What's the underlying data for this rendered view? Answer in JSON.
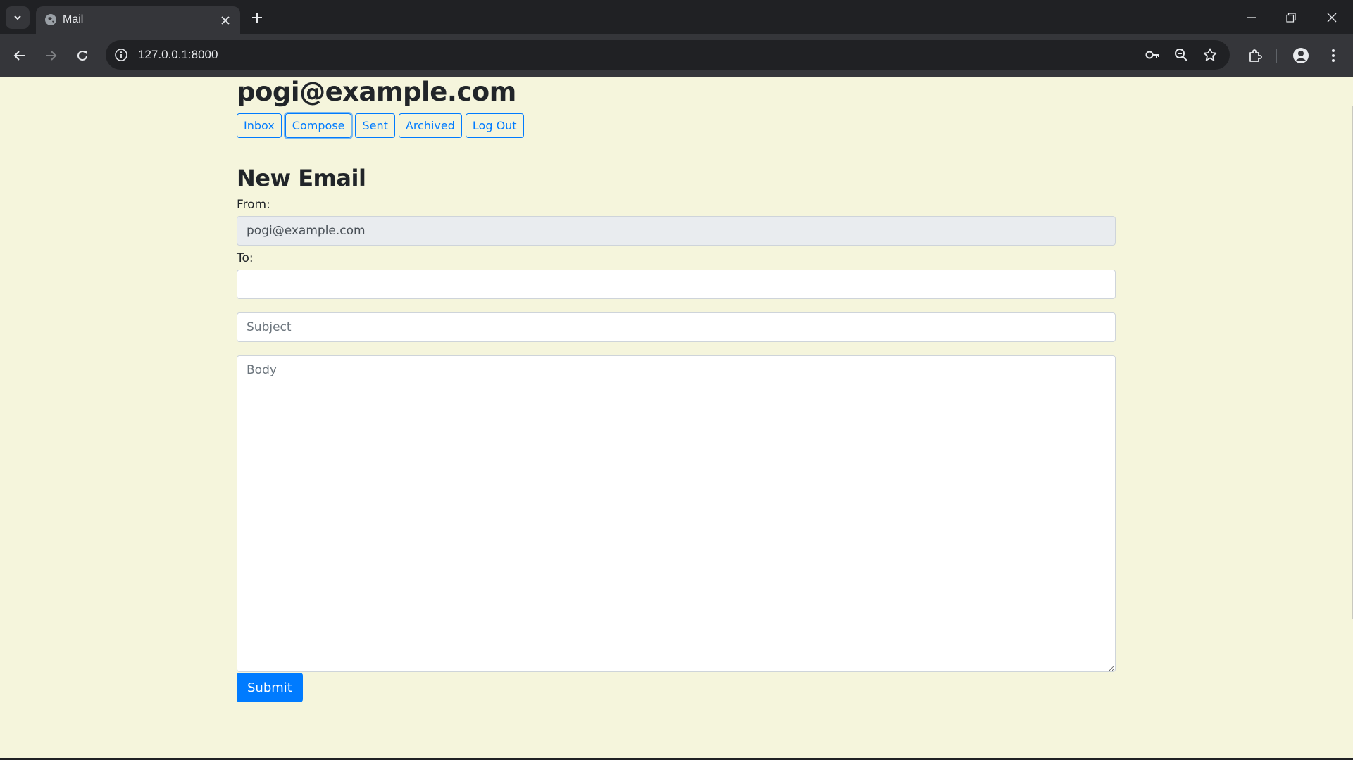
{
  "browser": {
    "tab_title": "Mail",
    "url": "127.0.0.1:8000"
  },
  "page": {
    "user_email": "pogi@example.com",
    "nav_buttons": [
      "Inbox",
      "Compose",
      "Sent",
      "Archived",
      "Log Out"
    ],
    "active_button": "Compose",
    "compose_heading": "New Email",
    "from_label": "From:",
    "from_value": "pogi@example.com",
    "to_label": "To:",
    "to_value": "",
    "subject_placeholder": "Subject",
    "body_placeholder": "Body",
    "submit_label": "Submit"
  },
  "colors": {
    "page_background": "#f5f5dc",
    "primary": "#007bff",
    "readonly_field": "#e9ecef"
  },
  "icons": {
    "browser": [
      "tab-search-icon",
      "globe-icon",
      "close-icon",
      "plus-icon",
      "minimize-icon",
      "restore-icon",
      "window-close-icon",
      "back-arrow-icon",
      "forward-arrow-icon",
      "reload-icon",
      "info-icon",
      "key-icon",
      "zoom-out-icon",
      "star-icon",
      "extensions-icon",
      "profile-icon",
      "more-vert-icon"
    ]
  }
}
